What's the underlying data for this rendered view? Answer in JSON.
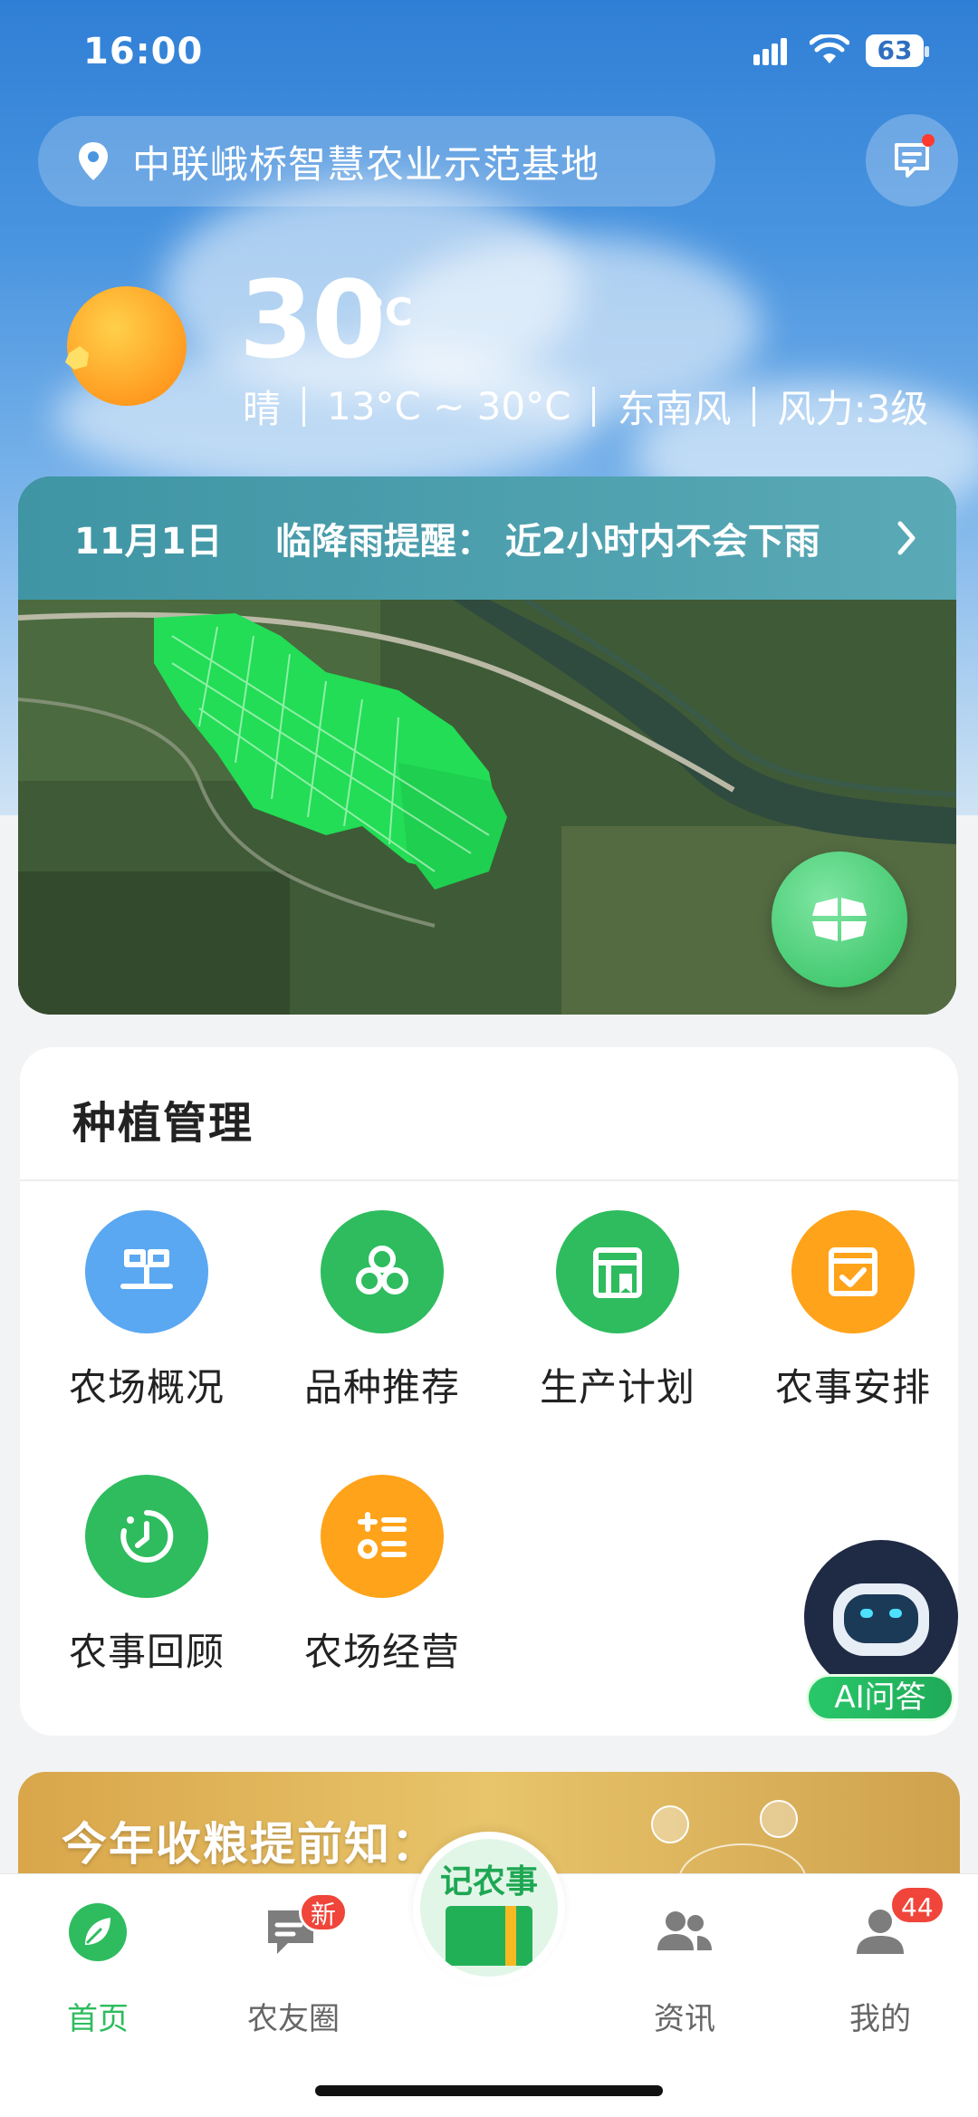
{
  "status_bar": {
    "time": "16:00",
    "battery": "63"
  },
  "location": {
    "name": "中联峨桥智慧农业示范基地"
  },
  "weather": {
    "temperature": "30",
    "unit": "°C",
    "condition": "晴",
    "range": "13°C ~ 30°C",
    "wind_direction": "东南风",
    "wind_level": "风力:3级"
  },
  "alert": {
    "date": "11月1日",
    "text": "临降雨提醒： 近2小时内不会下雨"
  },
  "planting": {
    "title": "种植管理",
    "items": [
      {
        "label": "农场概况",
        "icon": "farm-overview-icon",
        "color": "#5aa7f2"
      },
      {
        "label": "品种推荐",
        "icon": "variety-recommend-icon",
        "color": "#2ebc5e"
      },
      {
        "label": "生产计划",
        "icon": "production-plan-icon",
        "color": "#2ebc5e"
      },
      {
        "label": "农事安排",
        "icon": "farm-schedule-icon",
        "color": "#ffa31a"
      },
      {
        "label": "农事回顾",
        "icon": "farm-review-icon",
        "color": "#2ebc5e"
      },
      {
        "label": "农场经营",
        "icon": "farm-operation-icon",
        "color": "#ffa31a"
      }
    ]
  },
  "ai": {
    "label": "AI问答"
  },
  "harvest": {
    "title": "今年收粮提前知："
  },
  "tabs": [
    {
      "label": "首页",
      "active": true
    },
    {
      "label": "农友圈",
      "badge": "新"
    },
    {
      "label": "记农事"
    },
    {
      "label": "资讯"
    },
    {
      "label": "我的",
      "badge": "44"
    }
  ],
  "colors": {
    "accent": "#2ebc5e",
    "orange": "#ffa31a",
    "blue": "#5aa7f2",
    "badge": "#f0453a"
  }
}
